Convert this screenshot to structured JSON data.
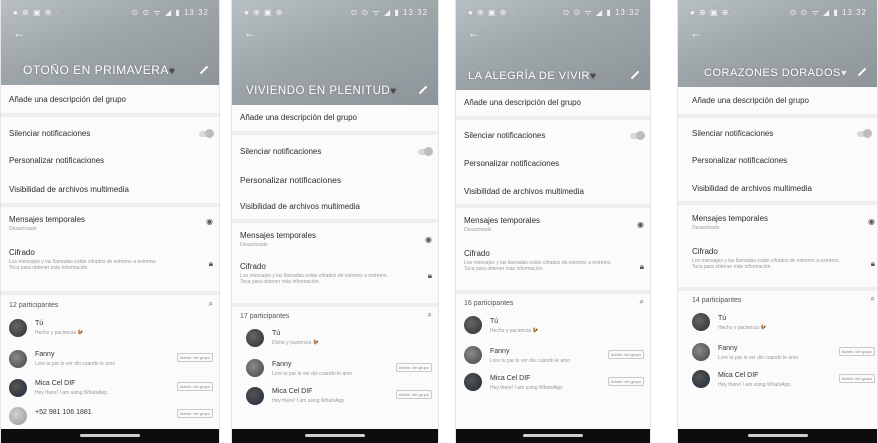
{
  "colors": {
    "header": "#9ea6aa",
    "background": "#fbfbfb",
    "navbar": "#0d0d0d"
  },
  "screens": [
    {
      "status_left": "● ⊕ ▣ ⊕ ·",
      "status_right": "⊙ ⊙ ᯤ ◢ ▮ 13:32",
      "title": "OTOÑO EN PRIMAVERA",
      "add_description": "Añade una descripción del grupo",
      "mute": "Silenciar notificaciones",
      "custom_notifications": "Personalizar notificaciones",
      "media_visibility": "Visibilidad de archivos multimedia",
      "temp_messages": "Mensajes temporales",
      "temp_messages_sub": "Desactivado",
      "encryption": "Cifrado",
      "encryption_sub": "Los mensajes y las llamadas están cifrados de extremo a extremo. Toca para obtener más información.",
      "participants_count": "12 participantes",
      "participants": [
        {
          "name": "Tú",
          "status": "Hecho y paciencia 🐓",
          "badge": ""
        },
        {
          "name": "Fanny",
          "status": "Lore tu par lo ver dio cuando le amo",
          "badge": "Admin. del grupo"
        },
        {
          "name": "Mica Cel DIF",
          "status": "Hey there! I am using WhatsApp.",
          "badge": "Admin. del grupo"
        },
        {
          "name": "+52 981 106 1881",
          "status": "",
          "badge": "Admin. del grupo"
        }
      ]
    },
    {
      "status_left": "● ⊕ ▣ ⊕ ·",
      "status_right": "⊙ ⊙ ᯤ ◢ ▮ 13:32",
      "title": "VIVIENDO EN PLENITUD",
      "add_description": "Añade una descripción del grupo",
      "mute": "Silenciar notificaciones",
      "custom_notifications": "Personalizar notificaciones",
      "media_visibility": "Visibilidad de archivos multimedia",
      "temp_messages": "Mensajes temporales",
      "temp_messages_sub": "Desactivado",
      "encryption": "Cifrado",
      "encryption_sub": "Los mensajes y las llamadas están cifrados de extremo a extremo. Toca para obtener más información.",
      "participants_count": "17 participantes",
      "participants": [
        {
          "name": "Tú",
          "status": "Dicho y paciencia 🐓",
          "badge": ""
        },
        {
          "name": "Fanny",
          "status": "Lore tu par lo ver dio cuando le amo",
          "badge": "Admin. del grupo"
        },
        {
          "name": "Mica Cel DIF",
          "status": "Hey there! I am using WhatsApp.",
          "badge": "Admin. del grupo"
        }
      ]
    },
    {
      "status_left": "● ⊕ ▣ ⊕ ·",
      "status_right": "⊙ ⊙ ᯤ ◢ ▮ 13:32",
      "title": "LA ALEGRÍA DE VIVIR",
      "add_description": "Añade una descripción del grupo",
      "mute": "Silenciar notificaciones",
      "custom_notifications": "Personalizar notificaciones",
      "media_visibility": "Visibilidad de archivos multimedia",
      "temp_messages": "Mensajes temporales",
      "temp_messages_sub": "Desactivado",
      "encryption": "Cifrado",
      "encryption_sub": "Los mensajes y las llamadas están cifrados de extremo a extremo. Toca para obtener más información.",
      "participants_count": "16 participantes",
      "participants": [
        {
          "name": "Tú",
          "status": "Hecho y paciencia 🐓",
          "badge": ""
        },
        {
          "name": "Fanny",
          "status": "Lore tu par lo ver dio cuando le amo",
          "badge": "Admin. del grupo"
        },
        {
          "name": "Mica Cel DIF",
          "status": "Hey there! I am using WhatsApp.",
          "badge": "Admin. del grupo"
        }
      ]
    },
    {
      "status_left": "● ⊕ ▣ ⊕ ·",
      "status_right": "⊙ ⊙ ᯤ ◢ ▮ 13:32",
      "title": "CORAZONES DORADOS",
      "add_description": "Añade una descripción del grupo",
      "mute": "Silenciar notificaciones",
      "custom_notifications": "Personalizar notificaciones",
      "media_visibility": "Visibilidad de archivos multimedia",
      "temp_messages": "Mensajes temporales",
      "temp_messages_sub": "Desactivado",
      "encryption": "Cifrado",
      "encryption_sub": "Los mensajes y las llamadas están cifrados de extremo a extremo. Toca para obtener más información.",
      "participants_count": "14 participantes",
      "participants": [
        {
          "name": "Tú",
          "status": "Hecho y paciencia 🐓",
          "badge": ""
        },
        {
          "name": "Fanny",
          "status": "Lore tu par lo ver dio cuando le amo",
          "badge": "Admin. del grupo"
        },
        {
          "name": "Mica Cel DIF",
          "status": "Hey there! I am using WhatsApp.",
          "badge": "Admin. del grupo"
        }
      ]
    }
  ]
}
